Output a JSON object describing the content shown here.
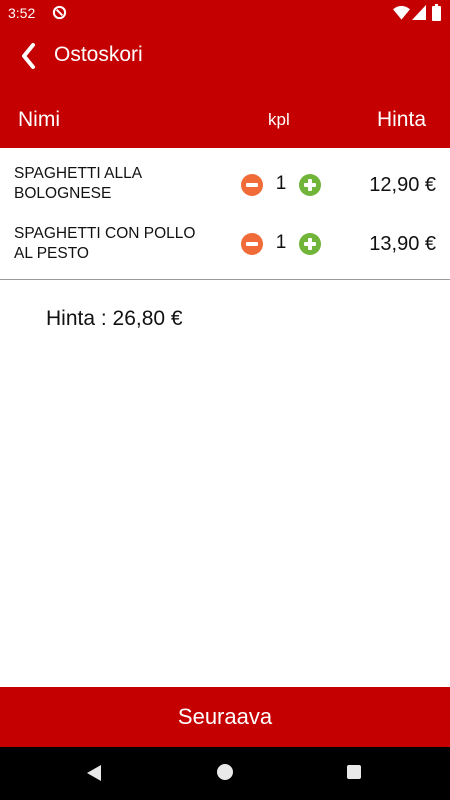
{
  "status_bar": {
    "time": "3:52",
    "background": "#c40000",
    "icons": [
      "app-notification-icon",
      "wifi-icon",
      "signal-icon",
      "battery-icon"
    ]
  },
  "toolbar": {
    "title": "Ostoskori",
    "back_icon": "chevron-left-icon"
  },
  "cart_header": {
    "name": "Nimi",
    "quantity": "kpl",
    "price": "Hinta"
  },
  "items": [
    {
      "name": "SPAGHETTI ALLA BOLOGNESE",
      "quantity": "1",
      "price": "12,90 €"
    },
    {
      "name": "SPAGHETTI CON POLLO AL PESTO",
      "quantity": "1",
      "price": "13,90 €"
    }
  ],
  "total": "Hinta : 26,80 €",
  "next_button": "Seuraava",
  "colors": {
    "brand": "#c40000",
    "minus_button": "#f06b38",
    "plus_button": "#71b43a"
  }
}
